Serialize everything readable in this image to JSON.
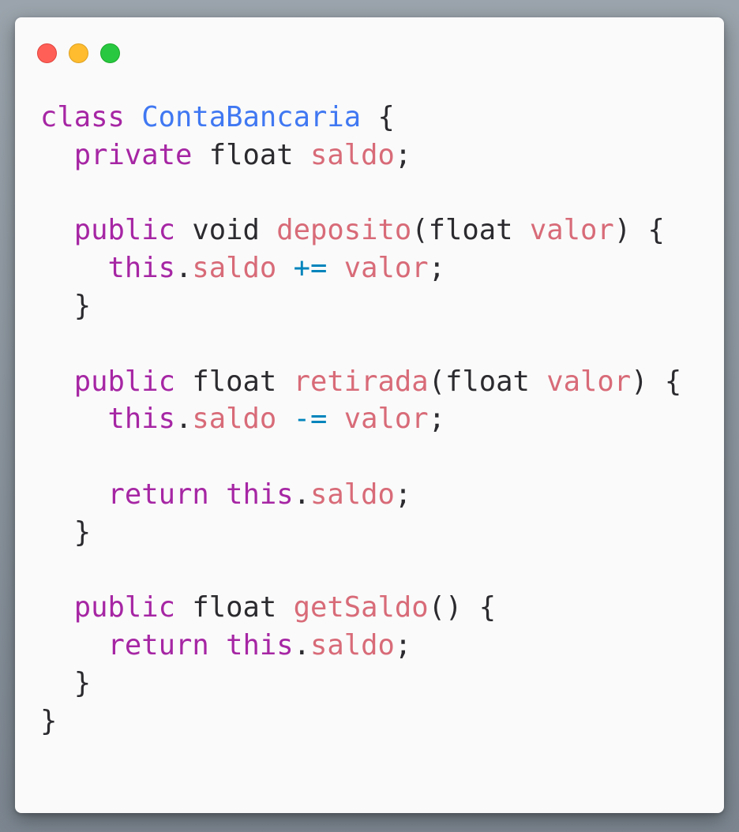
{
  "window": {
    "controls": [
      {
        "name": "close-button",
        "color": "#ff5f57"
      },
      {
        "name": "minimize-button",
        "color": "#febc2e"
      },
      {
        "name": "zoom-button",
        "color": "#28c840"
      }
    ]
  },
  "code": {
    "language": "java",
    "colors": {
      "keyword": "#a626a4",
      "class_name": "#4078f2",
      "identifier": "#d86b78",
      "operator": "#0184bc",
      "plain": "#2b2b2f",
      "background": "#fafafa"
    },
    "lines": [
      [
        {
          "t": "class",
          "k": "kw"
        },
        {
          "t": " ",
          "k": "plain"
        },
        {
          "t": "ContaBancaria",
          "k": "cls"
        },
        {
          "t": " {",
          "k": "plain"
        }
      ],
      [
        {
          "t": "  ",
          "k": "plain"
        },
        {
          "t": "private",
          "k": "kw"
        },
        {
          "t": " float ",
          "k": "plain"
        },
        {
          "t": "saldo",
          "k": "var"
        },
        {
          "t": ";",
          "k": "plain"
        }
      ],
      [],
      [
        {
          "t": "  ",
          "k": "plain"
        },
        {
          "t": "public",
          "k": "kw"
        },
        {
          "t": " void ",
          "k": "plain"
        },
        {
          "t": "deposito",
          "k": "fn"
        },
        {
          "t": "(float ",
          "k": "plain"
        },
        {
          "t": "valor",
          "k": "var"
        },
        {
          "t": ") {",
          "k": "plain"
        }
      ],
      [
        {
          "t": "    ",
          "k": "plain"
        },
        {
          "t": "this",
          "k": "kw"
        },
        {
          "t": ".",
          "k": "plain"
        },
        {
          "t": "saldo",
          "k": "var"
        },
        {
          "t": " ",
          "k": "plain"
        },
        {
          "t": "+=",
          "k": "op"
        },
        {
          "t": " ",
          "k": "plain"
        },
        {
          "t": "valor",
          "k": "var"
        },
        {
          "t": ";",
          "k": "plain"
        }
      ],
      [
        {
          "t": "  }",
          "k": "plain"
        }
      ],
      [],
      [
        {
          "t": "  ",
          "k": "plain"
        },
        {
          "t": "public",
          "k": "kw"
        },
        {
          "t": " float ",
          "k": "plain"
        },
        {
          "t": "retirada",
          "k": "fn"
        },
        {
          "t": "(float ",
          "k": "plain"
        },
        {
          "t": "valor",
          "k": "var"
        },
        {
          "t": ") {",
          "k": "plain"
        }
      ],
      [
        {
          "t": "    ",
          "k": "plain"
        },
        {
          "t": "this",
          "k": "kw"
        },
        {
          "t": ".",
          "k": "plain"
        },
        {
          "t": "saldo",
          "k": "var"
        },
        {
          "t": " ",
          "k": "plain"
        },
        {
          "t": "-=",
          "k": "op"
        },
        {
          "t": " ",
          "k": "plain"
        },
        {
          "t": "valor",
          "k": "var"
        },
        {
          "t": ";",
          "k": "plain"
        }
      ],
      [],
      [
        {
          "t": "    ",
          "k": "plain"
        },
        {
          "t": "return",
          "k": "kw"
        },
        {
          "t": " ",
          "k": "plain"
        },
        {
          "t": "this",
          "k": "kw"
        },
        {
          "t": ".",
          "k": "plain"
        },
        {
          "t": "saldo",
          "k": "var"
        },
        {
          "t": ";",
          "k": "plain"
        }
      ],
      [
        {
          "t": "  }",
          "k": "plain"
        }
      ],
      [],
      [
        {
          "t": "  ",
          "k": "plain"
        },
        {
          "t": "public",
          "k": "kw"
        },
        {
          "t": " float ",
          "k": "plain"
        },
        {
          "t": "getSaldo",
          "k": "fn"
        },
        {
          "t": "() {",
          "k": "plain"
        }
      ],
      [
        {
          "t": "    ",
          "k": "plain"
        },
        {
          "t": "return",
          "k": "kw"
        },
        {
          "t": " ",
          "k": "plain"
        },
        {
          "t": "this",
          "k": "kw"
        },
        {
          "t": ".",
          "k": "plain"
        },
        {
          "t": "saldo",
          "k": "var"
        },
        {
          "t": ";",
          "k": "plain"
        }
      ],
      [
        {
          "t": "  }",
          "k": "plain"
        }
      ],
      [
        {
          "t": "}",
          "k": "plain"
        }
      ]
    ]
  }
}
